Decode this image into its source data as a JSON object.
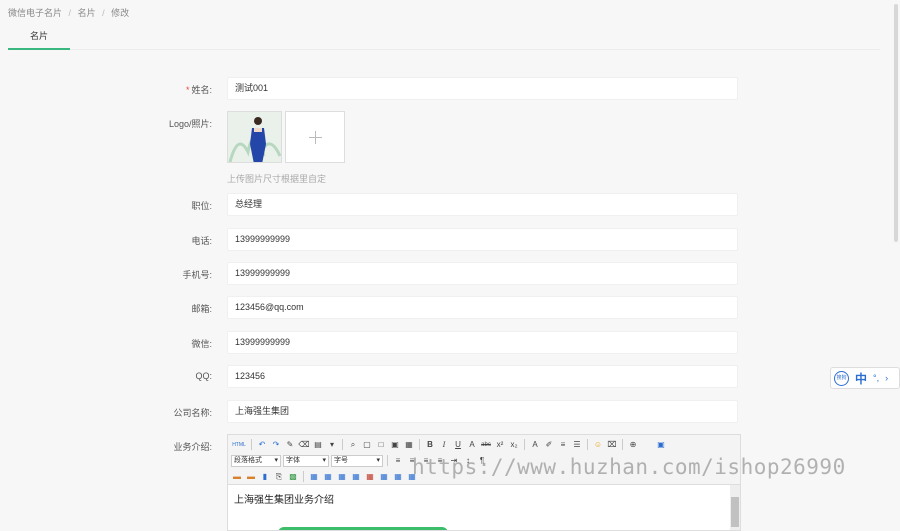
{
  "breadcrumb": {
    "items": [
      "微信电子名片",
      "名片",
      "修改"
    ],
    "separator": "/"
  },
  "tabs": [
    {
      "label": "名片"
    }
  ],
  "form": {
    "name": {
      "label": "姓名:",
      "value": "测试001",
      "required": true
    },
    "logo": {
      "label": "Logo/照片:",
      "hint": "上传图片尺寸根据里自定"
    },
    "position": {
      "label": "职位:",
      "value": "总经理"
    },
    "phone": {
      "label": "电话:",
      "value": "13999999999"
    },
    "mobile": {
      "label": "手机号:",
      "value": "13999999999"
    },
    "email": {
      "label": "邮箱:",
      "value": "123456@qq.com"
    },
    "wechat": {
      "label": "微信:",
      "value": "13999999999"
    },
    "qq": {
      "label": "QQ:",
      "value": "123456"
    },
    "company": {
      "label": "公司名称:",
      "value": "上海强生集团"
    },
    "business": {
      "label": "业务介绍:",
      "content": "上海强生集团业务介绍"
    }
  },
  "editor": {
    "paragraph_select": "段落格式",
    "font_select": "字体",
    "size_select": "字号",
    "html_label": "HTML"
  },
  "ime": {
    "zh": "中",
    "logo": "搜狗"
  },
  "watermark": "https://www.huzhan.com/ishop26990",
  "colors": {
    "accent": "#3ab77f",
    "required": "#e74c3c",
    "ime": "#2c6fd1"
  }
}
